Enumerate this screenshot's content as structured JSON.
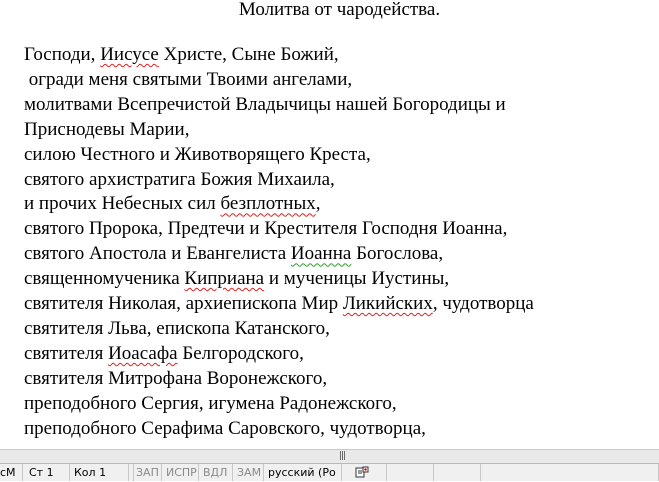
{
  "document": {
    "title": "Молитва от чародейства.",
    "lines": [
      [
        {
          "t": "Господи, "
        },
        {
          "t": "Иисусе",
          "sq": "red"
        },
        {
          "t": " Христе, Сыне Божий,"
        }
      ],
      [
        {
          "t": " огради меня святыми Твоими ангелами,"
        }
      ],
      [
        {
          "t": "молитвами Всепречистой Владычицы нашей Богородицы и"
        }
      ],
      [
        {
          "t": "Приснодевы Марии,"
        }
      ],
      [
        {
          "t": "силою Честного и Животворящего Креста,"
        }
      ],
      [
        {
          "t": "святого архистратига Божия Михаила,"
        }
      ],
      [
        {
          "t": "и прочих Небесных сил "
        },
        {
          "t": "безплотных",
          "sq": "red"
        },
        {
          "t": ","
        }
      ],
      [
        {
          "t": "святого Пророка, Предтечи и Крестителя Господня Иоанна,"
        }
      ],
      [
        {
          "t": "святого Апостола и Евангелиста "
        },
        {
          "t": "Иоанна",
          "sq": "green"
        },
        {
          "t": " Богослова,"
        }
      ],
      [
        {
          "t": "священномученика "
        },
        {
          "t": "Киприана",
          "sq": "red"
        },
        {
          "t": " и мученицы Иустины,"
        }
      ],
      [
        {
          "t": "святителя Николая, архиепископа Мир "
        },
        {
          "t": "Ликийских",
          "sq": "red"
        },
        {
          "t": ", чудотворца"
        }
      ],
      [
        {
          "t": "святителя Льва, епископа Катанского,"
        }
      ],
      [
        {
          "t": "святителя "
        },
        {
          "t": "Иоасафа",
          "sq": "red"
        },
        {
          "t": " Белгородского,"
        }
      ],
      [
        {
          "t": "святителя Митрофана Воронежского,"
        }
      ],
      [
        {
          "t": "преподобного Сергия, игумена Радонежского,"
        }
      ],
      [
        {
          "t": "преподобного Серафима Саровского, чудотворца,"
        }
      ]
    ]
  },
  "status_bar": {
    "cells": [
      {
        "text": "сМ",
        "dim": false
      },
      {
        "text": "Ст 1",
        "dim": false
      },
      {
        "text": "Кол 1",
        "dim": false
      },
      {
        "text": "",
        "dim": false
      },
      {
        "text": "ЗАП",
        "dim": true
      },
      {
        "text": "ИСПР",
        "dim": true
      },
      {
        "text": "ВДЛ",
        "dim": true
      },
      {
        "text": "ЗАМ",
        "dim": true
      },
      {
        "text": "русский (Ро",
        "dim": false
      }
    ],
    "macro_icon": "macro-record-icon",
    "colors": {
      "squiggle_spelling": "#e02020",
      "squiggle_grammar": "#2aa12a"
    }
  }
}
